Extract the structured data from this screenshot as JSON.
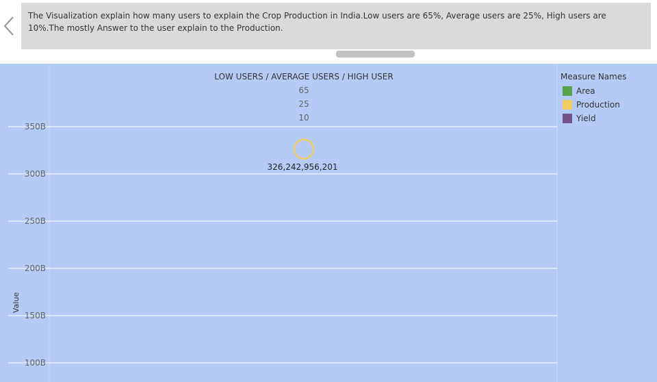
{
  "caption": {
    "text": "The Visualization explain how many users to explain the Crop Production in India.Low users are 65%, Average users are 25%, High users are 10%.The mostly Answer to the user explain to the Production."
  },
  "chart_data": {
    "type": "scatter",
    "title": "LOW USERS / AVERAGE USERS / HIGH USER",
    "header_values": [
      "65",
      "25",
      "10"
    ],
    "ylabel": "Value",
    "y_ticks": [
      100000000000,
      150000000000,
      200000000000,
      250000000000,
      300000000000,
      350000000000
    ],
    "y_tick_labels": [
      "100B",
      "150B",
      "200B",
      "250B",
      "300B",
      "350B"
    ],
    "ylim": [
      91000000000,
      352000000000
    ],
    "grid": true,
    "points": [
      {
        "series": "Production",
        "y": 326242956201,
        "label": "326,242,956,201"
      }
    ],
    "legend": {
      "title": "Measure Names",
      "position": "top-right",
      "items": [
        {
          "name": "Area",
          "color": "#59a14f"
        },
        {
          "name": "Production",
          "color": "#f1ce63"
        },
        {
          "name": "Yield",
          "color": "#76518a"
        }
      ]
    }
  }
}
